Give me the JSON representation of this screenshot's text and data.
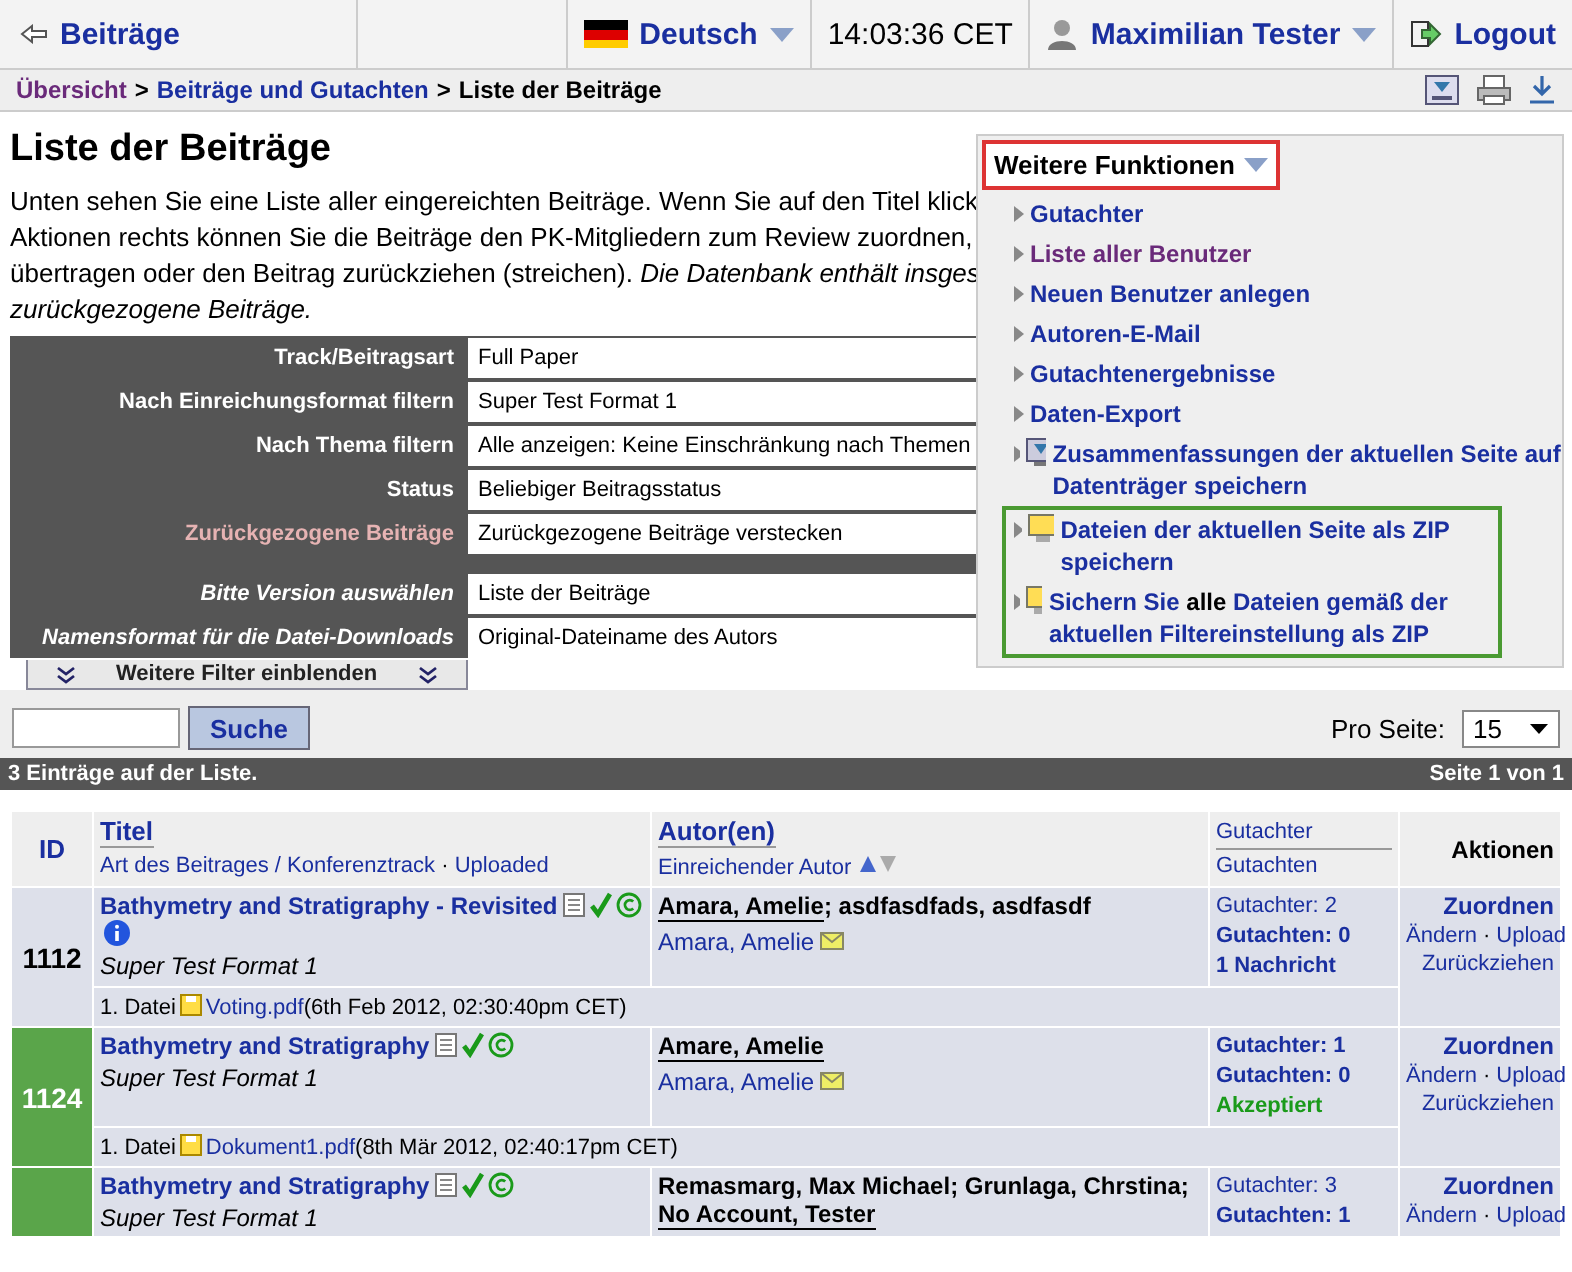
{
  "topbar": {
    "back": "Beiträge",
    "language": "Deutsch",
    "time": "14:03:36 CET",
    "user": "Maximilian Tester",
    "logout": "Logout"
  },
  "breadcrumb": [
    {
      "label": "Übersicht",
      "kind": "visited"
    },
    {
      "label": ">",
      "kind": "separator"
    },
    {
      "label": "Beiträge und Gutachten",
      "kind": "link"
    },
    {
      "label": ">",
      "kind": "separator"
    },
    {
      "label": "Liste der Beiträge",
      "kind": "current"
    }
  ],
  "title": "Liste der Beiträge",
  "intro": [
    "Unten sehen Sie eine Liste aller eingereichten Beiträge. Wenn Sie auf den Titel klick",
    "Aktionen rechts können Sie die Beiträge den PK-Mitgliedern zum Review zuordnen,",
    "übertragen oder den Beitrag zurückziehen (streichen). *Die Datenbank enthält insges*",
    "*zurückgezogene Beiträge.*"
  ],
  "filters": [
    {
      "label": "Track/Beitragsart",
      "value": "Full Paper",
      "kind": "normal"
    },
    {
      "label": "Nach Einreichungsformat filtern",
      "value": "Super Test Format 1",
      "kind": "normal"
    },
    {
      "label": "Nach Thema filtern",
      "value": "Alle anzeigen: Keine Einschränkung nach Themen",
      "kind": "normal"
    },
    {
      "label": "Status",
      "value": "Beliebiger Beitragsstatus",
      "kind": "normal"
    },
    {
      "label": "Zurückgezogene Beiträge",
      "value": "Zurückgezogene Beiträge verstecken",
      "kind": "accent"
    },
    {
      "label": "Bitte Version auswählen",
      "value": "Liste der Beiträge",
      "kind": "italic"
    },
    {
      "label": "Namensformat für die Datei-Downloads",
      "value": "Original-Dateiname des Autors",
      "kind": "italic"
    }
  ],
  "more_filters": "Weitere Filter einblenden",
  "search": {
    "button": "Suche"
  },
  "per_page": {
    "label": "Pro Seite:",
    "value": "15"
  },
  "list_bar": {
    "count": "3 Einträge auf der Liste.",
    "page": "Seite 1 von 1"
  },
  "menu": {
    "title": "Weitere Funktionen",
    "items": [
      {
        "label": "Gutachter",
        "kind": "link",
        "boxed": false
      },
      {
        "label": "Liste aller Benutzer",
        "kind": "visited",
        "boxed": false
      },
      {
        "label": "Neuen Benutzer anlegen",
        "kind": "link",
        "boxed": false
      },
      {
        "label": "Autoren-E-Mail",
        "kind": "link",
        "boxed": false
      },
      {
        "label": "Gutachtenergebnisse",
        "kind": "link",
        "boxed": false
      },
      {
        "label": "Daten-Export",
        "kind": "link",
        "boxed": false
      },
      {
        "label": "Zusammenfassungen der aktuellen Seite auf Datenträger speichern",
        "kind": "summary",
        "boxed": false
      },
      {
        "label": "Dateien der aktuellen Seite als ZIP speichern",
        "kind": "archive",
        "boxed": true
      },
      {
        "label": "Sichern Sie **alle** Dateien gemäß der aktuellen Filtereinstellung als ZIP",
        "kind": "archive",
        "boxed": true
      }
    ]
  },
  "table": {
    "columns": {
      "id": "ID",
      "title": "Titel",
      "track": "Art des Beitrages / Konferenztrack",
      "dot": "·",
      "uploaded": "Uploaded",
      "authors": "Autor(en)",
      "submitter": "Einreichender Autor",
      "reviewers": "Gutachter",
      "reviews": "Gutachten",
      "actions": "Aktionen"
    },
    "rows": [
      {
        "id": "1112",
        "highlighted": false,
        "title": "Bathymetry and Stratigraphy - Revisited",
        "info": true,
        "format": "Super Test Format 1",
        "authors": [
          {
            "text": "Amara, Amelie",
            "underlined": true
          },
          {
            "text": "; asdfasdfads, asdfasdf",
            "underlined": false
          }
        ],
        "submitter": "Amara, Amelie",
        "reviews": [
          {
            "text": "Gutachter: 2",
            "kind": "plain"
          },
          {
            "text": "Gutachten: 0",
            "kind": "bold"
          },
          {
            "text": "1 Nachricht",
            "kind": "bold"
          }
        ],
        "actions": {
          "primary": "Zuordnen",
          "links": [
            "Ändern",
            "·",
            "Upload"
          ],
          "last": "Zurückziehen"
        },
        "file": {
          "prefix": "1. Datei",
          "name": "Voting.pdf",
          "date": "(6th Feb 2012, 02:30:40pm CET)"
        }
      },
      {
        "id": "1124",
        "highlighted": true,
        "title": "Bathymetry and Stratigraphy",
        "info": false,
        "format": "Super Test Format 1",
        "authors": [
          {
            "text": "Amare, Amelie",
            "underlined": true
          }
        ],
        "submitter": "Amara, Amelie",
        "reviews": [
          {
            "text": "Gutachter: 1",
            "kind": "bold"
          },
          {
            "text": "Gutachten: 0",
            "kind": "bold"
          },
          {
            "text": "Akzeptiert",
            "kind": "accepted"
          }
        ],
        "actions": {
          "primary": "Zuordnen",
          "links": [
            "Ändern",
            "·",
            "Upload"
          ],
          "last": "Zurückziehen"
        },
        "file": {
          "prefix": "1. Datei",
          "name": "Dokument1.pdf",
          "date": "(8th Mär 2012, 02:40:17pm CET)"
        }
      },
      {
        "highlighted": true,
        "title": "Bathymetry and Stratigraphy",
        "info": false,
        "format": "Super Test Format 1",
        "authors": [
          {
            "text": "Remasmarg, Max Michael; Grunlaga, Chrstina; ",
            "underlined": false
          },
          {
            "text": "No Account, Tester",
            "underlined": true
          }
        ],
        "reviews": [
          {
            "text": "Gutachter: 3",
            "kind": "plain"
          },
          {
            "text": "Gutachten: 1",
            "kind": "bold"
          }
        ],
        "actions": {
          "primary": "Zuordnen",
          "links": [
            "Ändern",
            "·",
            "Upload"
          ]
        }
      }
    ]
  }
}
